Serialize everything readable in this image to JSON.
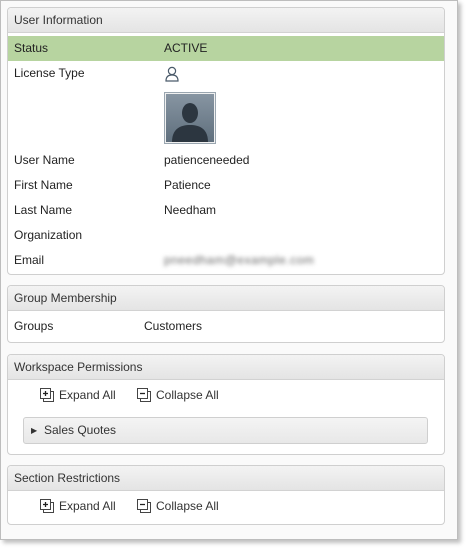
{
  "user_info": {
    "title": "User Information",
    "status_label": "Status",
    "status_value": "ACTIVE",
    "license_label": "License Type",
    "license_icon": "user-outline-icon",
    "avatar_icon": "user-silhouette-icon",
    "username_label": "User Name",
    "username_value": "patienceneeded",
    "firstname_label": "First Name",
    "firstname_value": "Patience",
    "lastname_label": "Last Name",
    "lastname_value": "Needham",
    "org_label": "Organization",
    "org_value": "",
    "email_label": "Email",
    "email_value": "pneedham@example.com"
  },
  "group_membership": {
    "title": "Group Membership",
    "groups_label": "Groups",
    "groups_value": "Customers"
  },
  "workspace_permissions": {
    "title": "Workspace Permissions",
    "expand_label": "Expand All",
    "collapse_label": "Collapse All",
    "item_label": "Sales Quotes"
  },
  "section_restrictions": {
    "title": "Section Restrictions",
    "expand_label": "Expand All",
    "collapse_label": "Collapse All"
  },
  "colors": {
    "status_row_bg": "#b7d4a0",
    "header_bg": "#e4e4e4"
  }
}
